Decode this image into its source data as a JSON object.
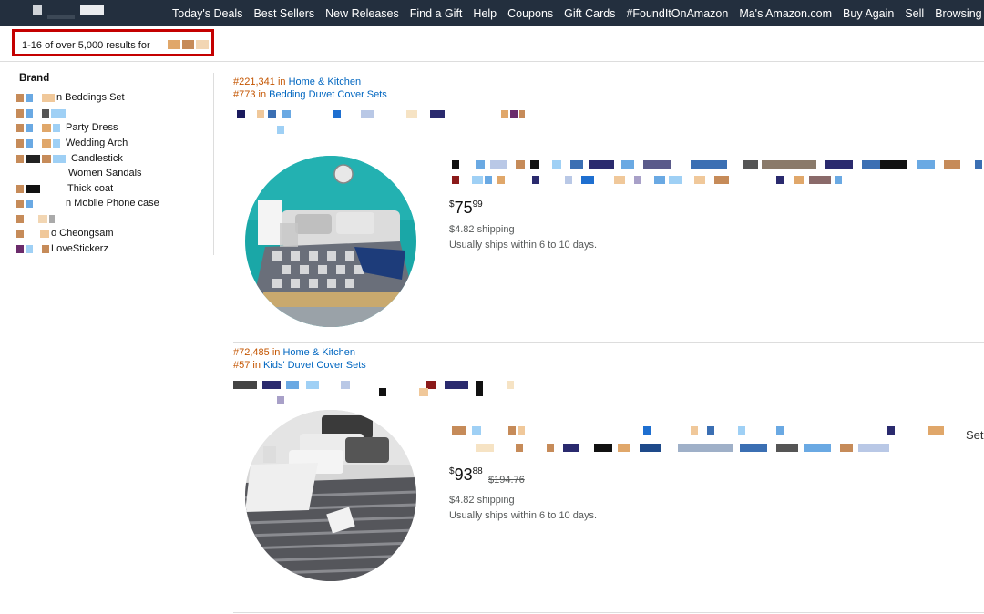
{
  "nav": {
    "links": [
      "Today's Deals",
      "Best Sellers",
      "New Releases",
      "Find a Gift",
      "Help",
      "Coupons",
      "Gift Cards",
      "#FoundItOnAmazon",
      "Ma's Amazon.com",
      "Buy Again",
      "Sell",
      "Browsing Histo"
    ]
  },
  "results": {
    "summary": "1-16 of over 5,000 results for"
  },
  "sidebar": {
    "title": "Brand",
    "items": [
      "n Beddings Set",
      "Party Dress",
      "Wedding Arch",
      "Candlestick",
      "Women Sandals",
      "Thick coat",
      "n Mobile Phone case",
      "o Cheongsam",
      "LoveStickerz"
    ]
  },
  "products": [
    {
      "rank1_num": "#221,341",
      "rank1_in": "in",
      "rank1_cat": "Home & Kitchen",
      "rank2_num": "#773",
      "rank2_in": "in",
      "rank2_cat": "Bedding Duvet Cover Sets",
      "price_whole": "75",
      "price_frac": "99",
      "price_currency": "$",
      "list_price": "",
      "shipping": "$4.82 shipping",
      "ships": "Usually ships within 6 to 10 days."
    },
    {
      "rank1_num": "#72,485",
      "rank1_in": "in",
      "rank1_cat": "Home & Kitchen",
      "rank2_num": "#57",
      "rank2_in": "in",
      "rank2_cat": "Kids' Duvet Cover Sets",
      "price_whole": "93",
      "price_frac": "88",
      "price_currency": "$",
      "list_price": "$194.76",
      "shipping": "$4.82 shipping",
      "ships": "Usually ships within 6 to 10 days.",
      "title_tail": "Set"
    }
  ],
  "icons": {
    "image1": "bed-teal-room-image",
    "image2": "bed-striped-grey-image"
  }
}
